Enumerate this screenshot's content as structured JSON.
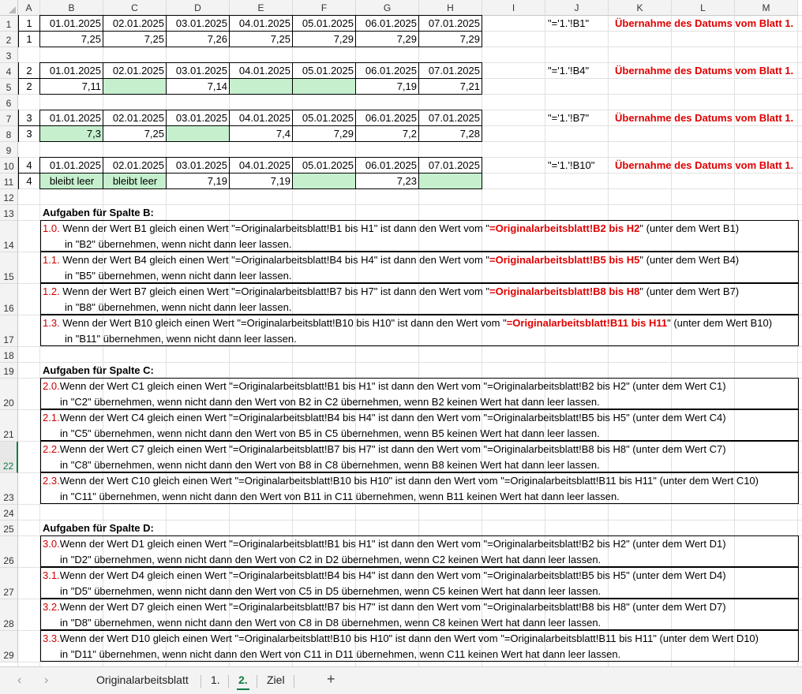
{
  "columns": [
    "A",
    "B",
    "C",
    "D",
    "E",
    "F",
    "G",
    "H",
    "I",
    "J",
    "K",
    "L",
    "M"
  ],
  "rows": [
    "1",
    "2",
    "3",
    "4",
    "5",
    "6",
    "7",
    "8",
    "9",
    "10",
    "11",
    "12",
    "13",
    "14",
    "15",
    "16",
    "17",
    "18",
    "19",
    "20",
    "21",
    "22",
    "23",
    "24",
    "25",
    "26",
    "27",
    "28",
    "29"
  ],
  "data_rows": [
    {
      "label": "1",
      "dates": [
        "01.01.2025",
        "02.01.2025",
        "03.01.2025",
        "04.01.2025",
        "05.01.2025",
        "06.01.2025",
        "07.01.2025"
      ],
      "value_label": "1",
      "values": [
        "7,25",
        "7,25",
        "7,26",
        "7,25",
        "7,29",
        "7,29",
        "7,29"
      ],
      "green": [
        false,
        false,
        false,
        false,
        false,
        false,
        false
      ],
      "formula": "\"='1.'!B1\"",
      "note": "Übernahme des Datums vom Blatt 1."
    },
    {
      "label": "2",
      "dates": [
        "01.01.2025",
        "02.01.2025",
        "03.01.2025",
        "04.01.2025",
        "05.01.2025",
        "06.01.2025",
        "07.01.2025"
      ],
      "value_label": "2",
      "values": [
        "7,11",
        "",
        "7,14",
        "",
        "",
        "7,19",
        "7,21"
      ],
      "green": [
        false,
        true,
        false,
        true,
        true,
        false,
        false
      ],
      "formula": "\"='1.'!B4\"",
      "note": "Übernahme des Datums vom Blatt 1."
    },
    {
      "label": "3",
      "dates": [
        "01.01.2025",
        "02.01.2025",
        "03.01.2025",
        "04.01.2025",
        "05.01.2025",
        "06.01.2025",
        "07.01.2025"
      ],
      "value_label": "3",
      "values": [
        "7,3",
        "7,25",
        "",
        "7,4",
        "7,29",
        "7,2",
        "7,28"
      ],
      "green": [
        true,
        false,
        true,
        false,
        false,
        false,
        false
      ],
      "formula": "\"='1.'!B7\"",
      "note": "Übernahme des Datums vom Blatt 1."
    },
    {
      "label": "4",
      "dates": [
        "01.01.2025",
        "02.01.2025",
        "03.01.2025",
        "04.01.2025",
        "05.01.2025",
        "06.01.2025",
        "07.01.2025"
      ],
      "value_label": "4",
      "values": [
        "bleibt leer",
        "bleibt leer",
        "7,19",
        "7,19",
        "",
        "7,23",
        ""
      ],
      "green": [
        true,
        true,
        false,
        false,
        true,
        false,
        true
      ],
      "formula": "\"='1.'!B10\"",
      "note": "Übernahme des Datums vom Blatt 1."
    }
  ],
  "sections": [
    {
      "heading": "Aufgaben für Spalte B:",
      "tasks": [
        {
          "num": "1.0.",
          "pre": " Wenn der Wert B1 gleich einen Wert \"=Originalarbeitsblatt!B1 bis H1\" ist dann den Wert vom \"",
          "hl": "=Originalarbeitsblatt!B2 bis H2",
          "post": "\" (unter dem Wert B1)",
          "line2": "in \"B2\" übernehmen, wenn nicht dann leer lassen."
        },
        {
          "num": "1.1.",
          "pre": " Wenn der Wert B4 gleich einen Wert \"=Originalarbeitsblatt!B4 bis H4\" ist dann den Wert vom \"",
          "hl": "=Originalarbeitsblatt!B5 bis H5",
          "post": "\" (unter dem Wert B4)",
          "line2": "in \"B5\" übernehmen, wenn nicht dann leer lassen."
        },
        {
          "num": "1.2.",
          "pre": " Wenn der Wert B7 gleich einen Wert \"=Originalarbeitsblatt!B7 bis H7\" ist dann den Wert vom \"",
          "hl": "=Originalarbeitsblatt!B8 bis H8",
          "post": "\" (unter dem Wert B7)",
          "line2": "in \"B8\" übernehmen, wenn nicht dann leer lassen."
        },
        {
          "num": "1.3.",
          "pre": " Wenn der Wert B10 gleich einen Wert \"=Originalarbeitsblatt!B10 bis H10\" ist dann den Wert vom \"",
          "hl": "=Originalarbeitsblatt!B11 bis H11",
          "post": "\" (unter dem Wert B10)",
          "line2": "in \"B11\" übernehmen, wenn nicht dann leer lassen."
        }
      ]
    },
    {
      "heading": "Aufgaben für Spalte C:",
      "tasks": [
        {
          "num": "2.0.",
          "pre": "Wenn der Wert C1 gleich einen Wert \"=Originalarbeitsblatt!B1 bis H1\" ist dann den Wert vom \"=Originalarbeitsblatt!B2 bis H2\" (unter dem Wert C1)",
          "hl": "",
          "post": "",
          "line2": "in \"C2\" übernehmen, wenn nicht dann den Wert von B2 in C2 übernehmen, wenn B2 keinen Wert hat dann leer lassen."
        },
        {
          "num": "2.1.",
          "pre": "Wenn der Wert C4 gleich einen Wert \"=Originalarbeitsblatt!B4 bis H4\" ist dann den Wert vom \"=Originalarbeitsblatt!B5 bis H5\" (unter dem Wert C4)",
          "hl": "",
          "post": "",
          "line2": "in \"C5\" übernehmen, wenn nicht dann den Wert von B5 in C5 übernehmen, wenn B5 keinen Wert hat dann leer lassen."
        },
        {
          "num": "2.2.",
          "pre": "Wenn der Wert C7 gleich einen Wert \"=Originalarbeitsblatt!B7 bis H7\" ist dann den Wert vom \"=Originalarbeitsblatt!B8 bis H8\" (unter dem Wert C7)",
          "hl": "",
          "post": "",
          "line2": "in \"C8\" übernehmen, wenn nicht dann den Wert von B8 in C8 übernehmen, wenn B8 keinen Wert hat dann leer lassen."
        },
        {
          "num": "2.3.",
          "pre": "Wenn der Wert C10 gleich einen Wert \"=Originalarbeitsblatt!B10 bis H10\" ist dann den Wert vom \"=Originalarbeitsblatt!B11 bis H11\" (unter dem Wert C10)",
          "hl": "",
          "post": "",
          "line2": "in \"C11\" übernehmen, wenn nicht dann den Wert von B11 in C11 übernehmen, wenn B11 keinen Wert hat dann leer lassen."
        }
      ]
    },
    {
      "heading": "Aufgaben für Spalte D:",
      "tasks": [
        {
          "num": "3.0.",
          "pre": "Wenn der Wert D1 gleich einen Wert \"=Originalarbeitsblatt!B1 bis H1\" ist dann den Wert vom \"=Originalarbeitsblatt!B2 bis H2\" (unter dem Wert D1)",
          "hl": "",
          "post": "",
          "line2": "in \"D2\" übernehmen, wenn nicht dann den Wert von C2 in D2 übernehmen, wenn C2 keinen Wert hat dann leer lassen."
        },
        {
          "num": "3.1.",
          "pre": "Wenn der Wert D4 gleich einen Wert \"=Originalarbeitsblatt!B4 bis H4\" ist dann den Wert vom \"=Originalarbeitsblatt!B5 bis H5\" (unter dem Wert D4)",
          "hl": "",
          "post": "",
          "line2": "in \"D5\" übernehmen, wenn nicht dann den Wert von C5 in D5 übernehmen, wenn C5 keinen Wert hat dann leer lassen."
        },
        {
          "num": "3.2.",
          "pre": "Wenn der Wert D7 gleich einen Wert \"=Originalarbeitsblatt!B7 bis H7\" ist dann den Wert vom \"=Originalarbeitsblatt!B8 bis H8\" (unter dem Wert D7)",
          "hl": "",
          "post": "",
          "line2": "in \"D8\" übernehmen, wenn nicht dann den Wert von C8 in D8 übernehmen, wenn C8 keinen Wert hat dann leer lassen."
        },
        {
          "num": "3.3.",
          "pre": "Wenn der Wert D10 gleich einen Wert \"=Originalarbeitsblatt!B10 bis H10\" ist dann den Wert vom \"=Originalarbeitsblatt!B11 bis H11\" (unter dem Wert D10)",
          "hl": "",
          "post": "",
          "line2": "in \"D11\" übernehmen, wenn nicht dann den Wert von C11 in D11 übernehmen, wenn C11 keinen Wert hat dann leer lassen."
        }
      ]
    }
  ],
  "tabs": {
    "prev_icon": "chevron-left-icon",
    "next_icon": "chevron-right-icon",
    "items": [
      "Originalarbeitsblatt",
      "1.",
      "2.",
      "Ziel"
    ],
    "active": "2.",
    "add_icon": "plus-icon"
  },
  "colors": {
    "accent": "#107c41",
    "green_fill": "#c6efce",
    "red_text": "#e00000"
  }
}
